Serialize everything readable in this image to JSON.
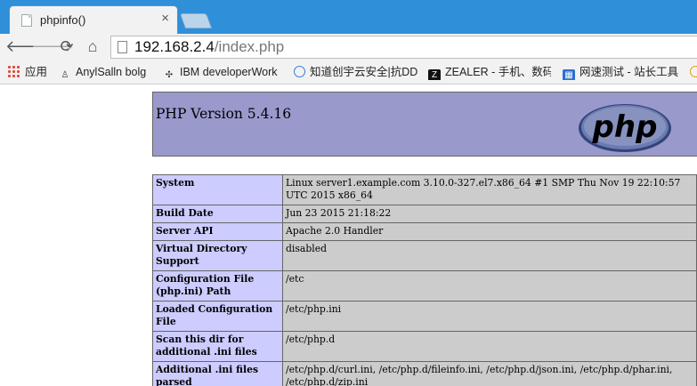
{
  "browser": {
    "tab_title": "phpinfo()",
    "tab_close": "×",
    "url_host": "192.168.2.4",
    "url_path": "/index.php"
  },
  "bookmarks": [
    {
      "label": "应用",
      "icon": "apps-icon"
    },
    {
      "label": "AnylSalln bolg",
      "icon": "person-icon"
    },
    {
      "label": "IBM developerWork",
      "icon": "ibm-icon"
    },
    {
      "label": "知道创宇云安全|抗DD",
      "icon": "cloud-shield-icon"
    },
    {
      "label": "ZEALER - 手机、数码",
      "icon": "zealer-icon"
    },
    {
      "label": "网速测试 - 站长工具",
      "icon": "speedtest-icon"
    }
  ],
  "page": {
    "version_title": "PHP Version 5.4.16",
    "logo_text": "php",
    "rows": [
      {
        "key": "System",
        "value": "Linux server1.example.com 3.10.0-327.el7.x86_64 #1 SMP Thu Nov 19 22:10:57 UTC 2015 x86_64"
      },
      {
        "key": "Build Date",
        "value": "Jun 23 2015 21:18:22"
      },
      {
        "key": "Server API",
        "value": "Apache 2.0 Handler"
      },
      {
        "key": "Virtual Directory Support",
        "value": "disabled"
      },
      {
        "key": "Configuration File (php.ini) Path",
        "value": "/etc"
      },
      {
        "key": "Loaded Configuration File",
        "value": "/etc/php.ini"
      },
      {
        "key": "Scan this dir for additional .ini files",
        "value": "/etc/php.d"
      },
      {
        "key": "Additional .ini files parsed",
        "value": "/etc/php.d/curl.ini, /etc/php.d/fileinfo.ini, /etc/php.d/json.ini, /etc/php.d/phar.ini, /etc/php.d/zip.ini"
      }
    ]
  },
  "colors": {
    "header_bg": "#9999cc",
    "key_bg": "#ccccff",
    "value_bg": "#cccccc",
    "tabstrip_bg": "#2f8fd9"
  }
}
